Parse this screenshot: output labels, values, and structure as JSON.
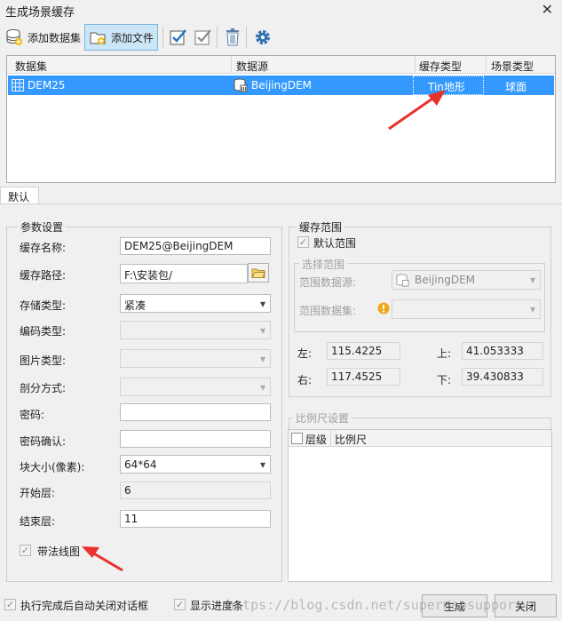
{
  "window": {
    "title": "生成场景缓存"
  },
  "toolbar": {
    "add_dataset_label": "添加数据集",
    "add_file_label": "添加文件",
    "icons": [
      "database-add-icon",
      "folder-add-icon",
      "select-all-icon",
      "invert-select-icon",
      "delete-icon",
      "settings-icon"
    ]
  },
  "table": {
    "columns": [
      "数据集",
      "数据源",
      "缓存类型",
      "场景类型"
    ],
    "rows": [
      {
        "dataset": "DEM25",
        "datasource": "BeijingDEM",
        "cache_type": "Tin地形",
        "scene_type": "球面"
      }
    ]
  },
  "tab": {
    "label": "默认"
  },
  "params": {
    "group_label": "参数设置",
    "cache_name_label": "缓存名称:",
    "cache_name_value": "DEM25@BeijingDEM",
    "cache_path_label": "缓存路径:",
    "cache_path_value": "F:\\安装包/",
    "storage_type_label": "存储类型:",
    "storage_type_value": "紧凑",
    "encoding_type_label": "编码类型:",
    "image_type_label": "图片类型:",
    "split_mode_label": "剖分方式:",
    "password_label": "密码:",
    "password_confirm_label": "密码确认:",
    "block_size_label": "块大小(像素):",
    "block_size_value": "64*64",
    "start_level_label": "开始层:",
    "start_level_value": "6",
    "end_level_label": "结束层:",
    "end_level_value": "11",
    "normal_map_label": "带法线图",
    "normal_map_checked": true
  },
  "cache_range": {
    "group_label": "缓存范围",
    "default_range_label": "默认范围",
    "default_range_checked": true,
    "select_range_label": "选择范围",
    "range_datasource_label": "范围数据源:",
    "range_datasource_value": "BeijingDEM",
    "range_dataset_label": "范围数据集:",
    "left_label": "左:",
    "left_value": "115.4225",
    "top_label": "上:",
    "top_value": "41.053333",
    "right_label": "右:",
    "right_value": "117.4525",
    "bottom_label": "下:",
    "bottom_value": "39.430833"
  },
  "scale": {
    "group_label": "比例尺设置",
    "columns": [
      "层级",
      "比例尺"
    ]
  },
  "footer": {
    "auto_close_label": "执行完成后自动关闭对话框",
    "auto_close_checked": true,
    "show_progress_label": "显示进度条",
    "show_progress_checked": true,
    "generate_label": "生成",
    "close_label": "关闭"
  },
  "watermark": "https://blog.csdn.net/supermapsupport",
  "colors": {
    "selection": "#3399ff",
    "annotation_arrow": "#e8322b",
    "toolbar_active": "#cde6f7"
  }
}
